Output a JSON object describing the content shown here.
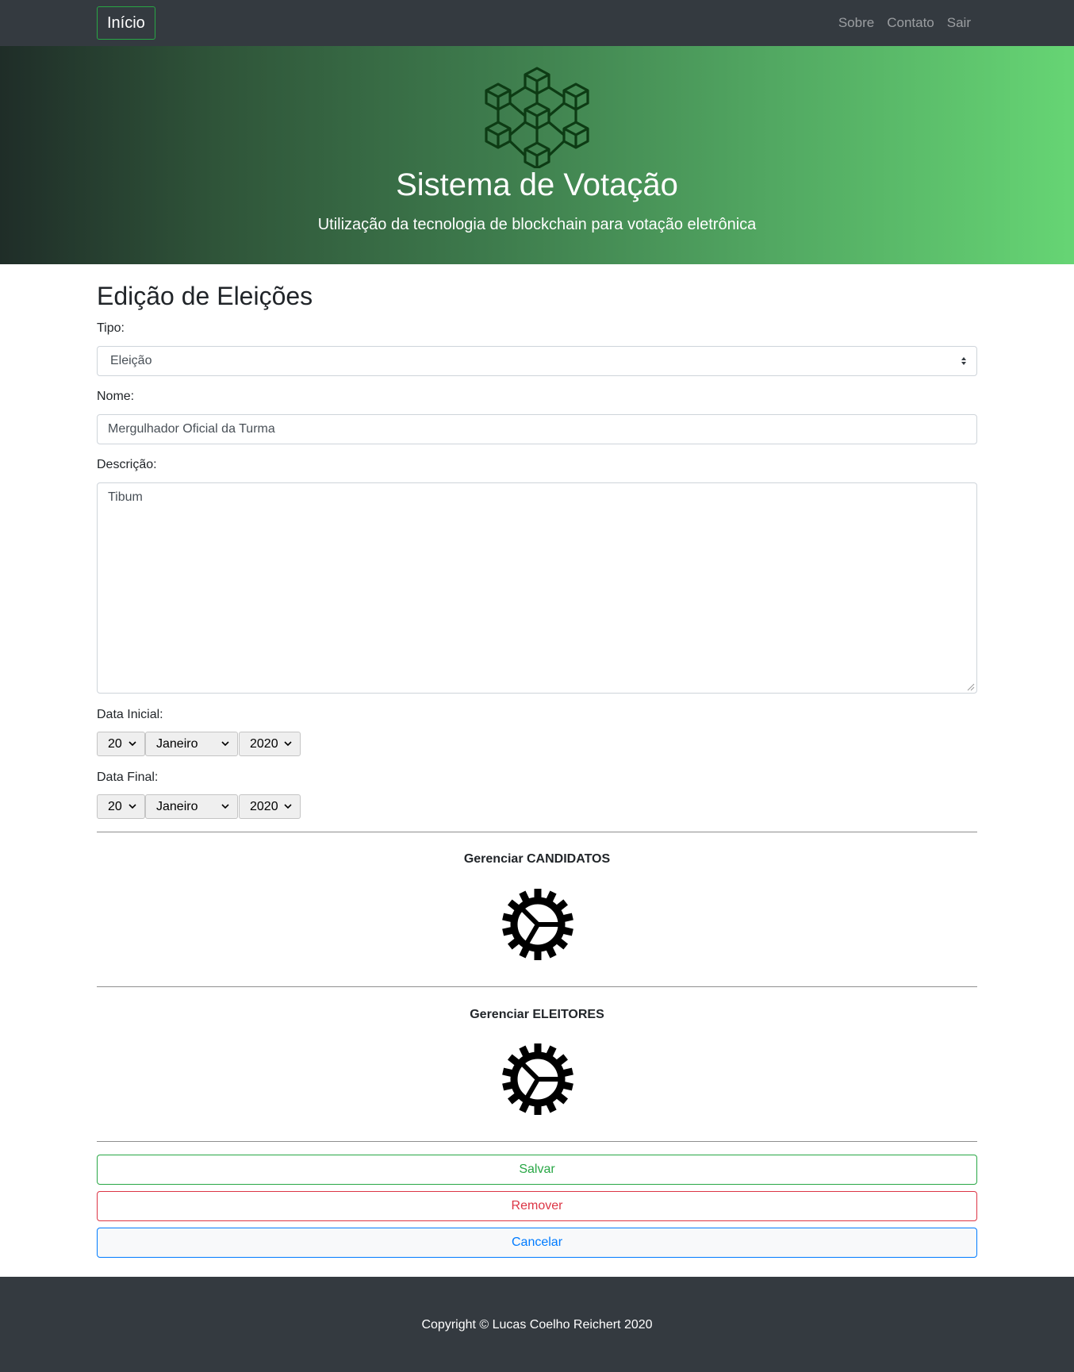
{
  "nav": {
    "brand": "Início",
    "links": [
      "Sobre",
      "Contato",
      "Sair"
    ]
  },
  "hero": {
    "title": "Sistema de Votação",
    "subtitle": "Utilização da tecnologia de blockchain para votação eletrônica",
    "logo_icon": "blockchain-cubes-icon",
    "logo_color": "#0d3b14"
  },
  "form": {
    "page_title": "Edição de Eleições",
    "tipo_label": "Tipo:",
    "tipo_value": "Eleição",
    "nome_label": "Nome:",
    "nome_value": "Mergulhador Oficial da Turma",
    "descricao_label": "Descrição:",
    "descricao_value": "Tibum",
    "data_inicial_label": "Data Inicial:",
    "data_inicial": {
      "day": "20",
      "month": "Janeiro",
      "year": "2020"
    },
    "data_final_label": "Data Final:",
    "data_final": {
      "day": "20",
      "month": "Janeiro",
      "year": "2020"
    }
  },
  "manage": {
    "candidatos_title": "Gerenciar CANDIDATOS",
    "eleitores_title": "Gerenciar ELEITORES",
    "icon": "gear-icon"
  },
  "actions": {
    "save": "Salvar",
    "remove": "Remover",
    "cancel": "Cancelar"
  },
  "colors": {
    "navbar": "#343a40",
    "success": "#28a745",
    "danger": "#dc3545",
    "primary": "#007bff"
  },
  "footer": {
    "copyright": "Copyright © Lucas Coelho Reichert 2020"
  }
}
